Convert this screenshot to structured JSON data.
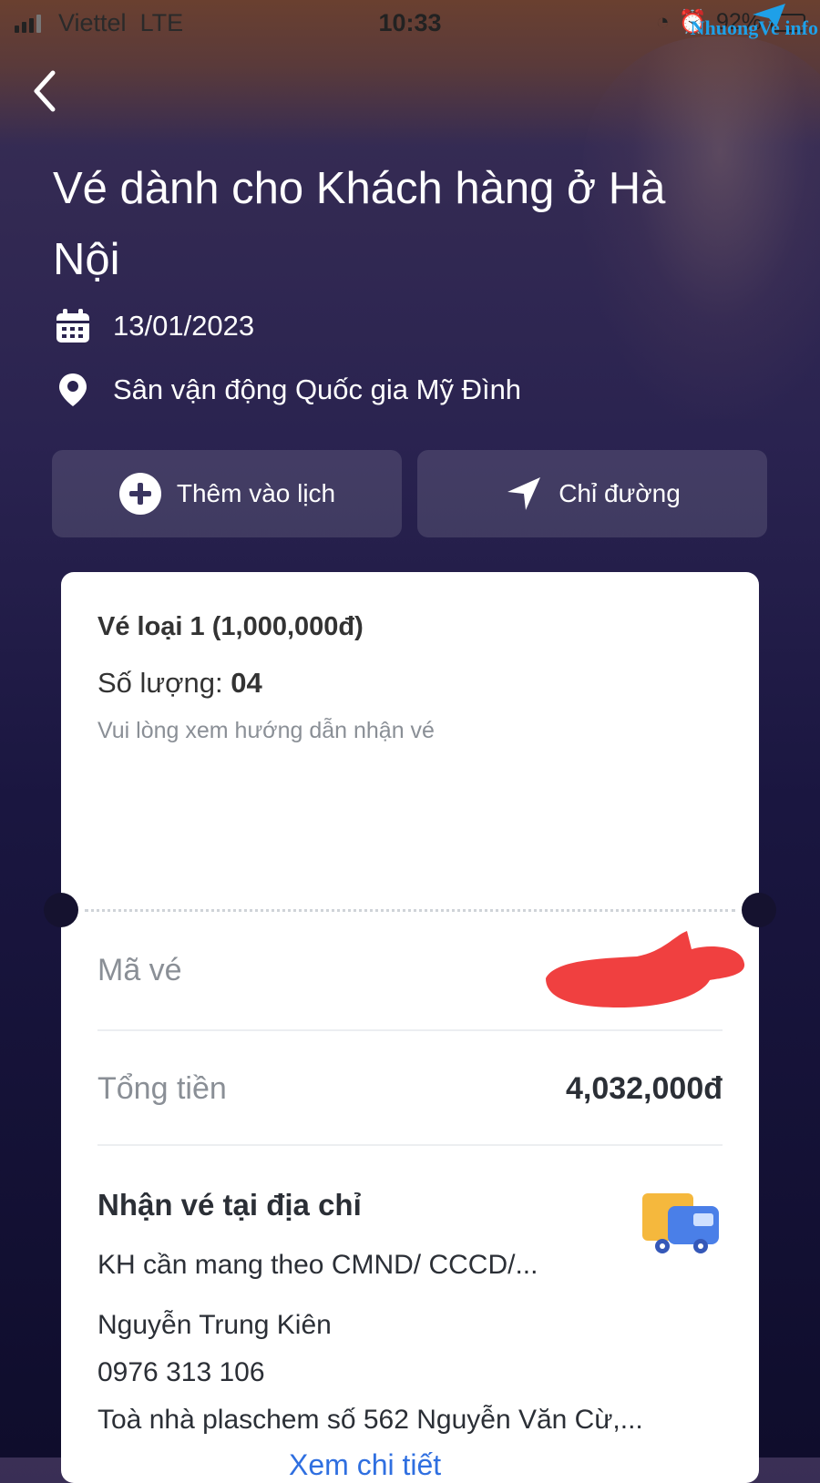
{
  "status_bar": {
    "carrier": "Viettel",
    "network": "LTE",
    "time": "10:33",
    "battery": "92%",
    "watermark_text": "NhuongVe info"
  },
  "header": {
    "title": "Vé dành cho Khách hàng ở Hà Nội",
    "date": "13/01/2023",
    "venue": "Sân vận động Quốc gia Mỹ Đình"
  },
  "actions": {
    "add_calendar_label": "Thêm vào lịch",
    "directions_label": "Chỉ đường"
  },
  "ticket": {
    "type_label": "Vé loại 1 (1,000,000đ)",
    "quantity_label": "Số lượng:",
    "quantity_value": "04",
    "hint": "Vui lòng xem hướng dẫn nhận vé",
    "code_label": "Mã vé",
    "total_label": "Tổng tiền",
    "total_value": "4,032,000đ"
  },
  "delivery": {
    "title": "Nhận vé tại địa chỉ",
    "note": "KH cần mang theo CMND/ CCCD/...",
    "recipient_name": "Nguyễn Trung Kiên",
    "phone": "0976 313 106",
    "address": "Toà nhà plaschem số 562 Nguyễn Văn Cừ,...",
    "details_link": "Xem chi tiết"
  },
  "icons": {
    "back": "chevron-left-icon",
    "calendar": "calendar-icon",
    "location": "location-pin-icon",
    "add": "plus-circle-icon",
    "navigate": "navigation-arrow-icon",
    "truck": "delivery-truck-icon"
  },
  "colors": {
    "background_top": "#3a2f55",
    "background_bottom": "#0f0d2c",
    "link": "#2f6fe0",
    "redaction": "#f04040"
  }
}
